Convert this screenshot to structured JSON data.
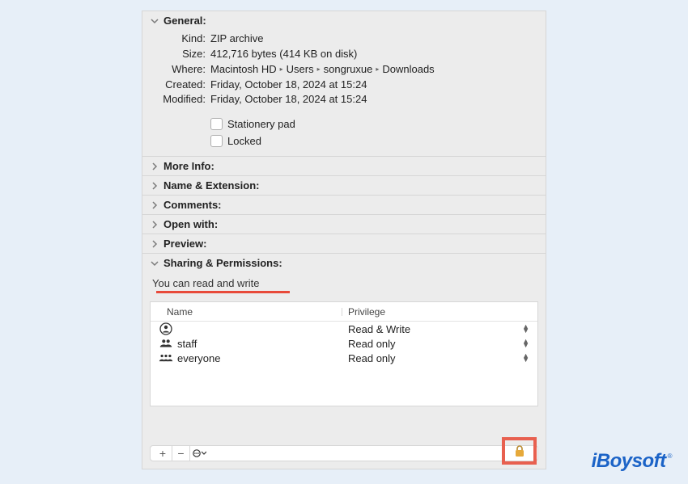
{
  "sections": {
    "general": "General:",
    "more_info": "More Info:",
    "name_ext": "Name & Extension:",
    "comments": "Comments:",
    "open_with": "Open with:",
    "preview": "Preview:",
    "sharing": "Sharing & Permissions:"
  },
  "general": {
    "kind_label": "Kind:",
    "kind_value": "ZIP archive",
    "size_label": "Size:",
    "size_value": "412,716 bytes (414 KB on disk)",
    "where_label": "Where:",
    "where_parts": [
      "Macintosh HD",
      "Users",
      "songruxue",
      "Downloads"
    ],
    "created_label": "Created:",
    "created_value": "Friday, October 18, 2024 at 15:24",
    "modified_label": "Modified:",
    "modified_value": "Friday, October 18, 2024 at 15:24",
    "stationery": "Stationery pad",
    "locked": "Locked"
  },
  "permissions": {
    "message": "You can read and write",
    "headers": {
      "name": "Name",
      "priv": "Privilege"
    },
    "rows": [
      {
        "icon": "person",
        "name": "",
        "priv": "Read & Write"
      },
      {
        "icon": "group",
        "name": "staff",
        "priv": "Read only"
      },
      {
        "icon": "all",
        "name": "everyone",
        "priv": "Read only"
      }
    ],
    "add": "+",
    "remove": "−",
    "action": "⊙"
  },
  "watermark": "iBoysoft",
  "tm": "®"
}
